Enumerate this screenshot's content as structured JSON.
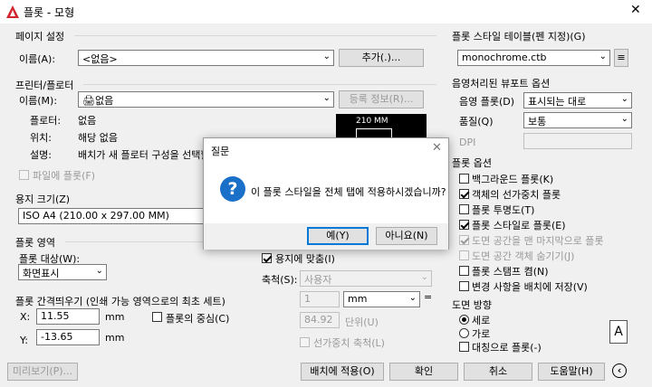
{
  "window": {
    "title": "플롯 - 모형",
    "close": "✕"
  },
  "page_setup": {
    "group": "페이지 설정",
    "name_label": "이름(A):",
    "name_value": "<없음>",
    "add_button": "추가(.)..."
  },
  "printer": {
    "group": "프린터/플로터",
    "name_label": "이름(M):",
    "name_value": "없음",
    "properties_button": "등록 정보(R)...",
    "plotter_label": "플로터:",
    "plotter_value": "없음",
    "location_label": "위치:",
    "location_value": "해당 없음",
    "description_label": "설명:",
    "description_value": "배치가 새 플로터 구성을 선택할",
    "plot_to_file": "파일에 플롯(F)",
    "preview_dim": "210 MM"
  },
  "paper_size": {
    "group": "용지 크기(Z)",
    "value": "ISO A4 (210.00 x 297.00 MM)"
  },
  "plot_area": {
    "group": "플롯 영역",
    "what_label": "플롯 대상(W):",
    "what_value": "화면표시"
  },
  "plot_offset": {
    "group": "플롯 간격띄우기 (인쇄 가능 영역으로의 최초 세트)",
    "x_label": "X:",
    "x_value": "11.55",
    "x_unit": "mm",
    "center": "플롯의 중심(C)",
    "y_label": "Y:",
    "y_value": "-13.65",
    "y_unit": "mm"
  },
  "plot_scale": {
    "fit": "용지에 맞춤(I)",
    "scale_label": "축척(S):",
    "scale_value": "사용자",
    "value1": "1",
    "unit1": "mm",
    "value2": "84.92",
    "unit2": "단위(U)",
    "lineweights": "선가중치 축척(L)"
  },
  "plot_style_table": {
    "group": "플롯 스타일 테이블(펜 지정)(G)",
    "value": "monochrome.ctb"
  },
  "shaded_viewport": {
    "group": "음영처리된 뷰포트 옵션",
    "shade_label": "음영 플롯(D)",
    "shade_value": "표시되는 대로",
    "quality_label": "품질(Q)",
    "quality_value": "보통",
    "dpi_label": "DPI"
  },
  "plot_options": {
    "group": "플롯 옵션",
    "items": [
      {
        "label": "백그라운드 플롯(K)",
        "checked": false,
        "disabled": false
      },
      {
        "label": "객체의 선가중치 플롯",
        "checked": true,
        "disabled": false
      },
      {
        "label": "플롯 투명도(T)",
        "checked": false,
        "disabled": false
      },
      {
        "label": "플롯 스타일로 플롯(E)",
        "checked": true,
        "disabled": false
      },
      {
        "label": "도면 공간을 맨 마지막으로 플롯",
        "checked": true,
        "disabled": true
      },
      {
        "label": "도면 공간 객체 숨기기(J)",
        "checked": false,
        "disabled": true
      },
      {
        "label": "플롯 스탬프 켬(N)",
        "checked": false,
        "disabled": false
      },
      {
        "label": "변경 사항을 배치에 저장(V)",
        "checked": false,
        "disabled": false
      }
    ]
  },
  "orientation": {
    "group": "도면 방향",
    "portrait": "세로",
    "landscape": "가로",
    "upside_down": "대칭으로 플롯(-)",
    "icon_letter": "A"
  },
  "bottom": {
    "preview": "미리보기(P)...",
    "apply": "배치에 적용(O)",
    "ok": "확인",
    "cancel": "취소",
    "help": "도움말(H)"
  },
  "dialog": {
    "title": "질문",
    "message": "이 플롯 스타일을 전체 탭에 적용하시겠습니까?",
    "yes": "예(Y)",
    "no": "아니요(N)",
    "icon": "question-icon"
  },
  "colors": {
    "accent": "#0078d7",
    "question_icon": "#1a6fc9"
  }
}
